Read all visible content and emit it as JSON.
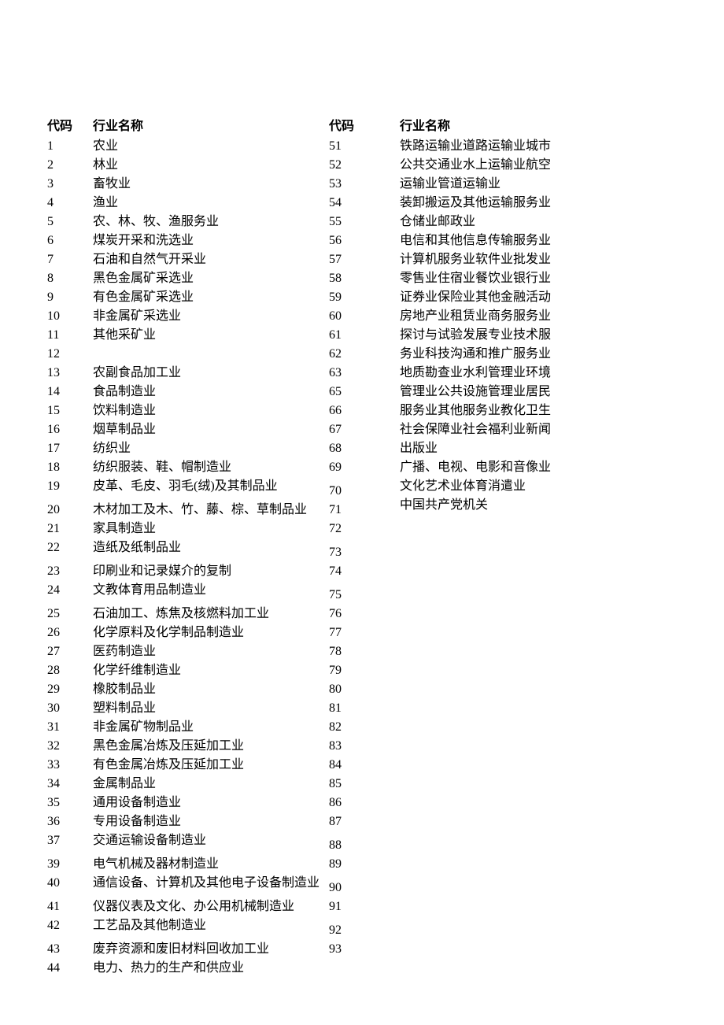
{
  "headers": {
    "code": "代码",
    "name": "行业名称"
  },
  "left_rows": [
    {
      "code": "1",
      "name": "农业"
    },
    {
      "code": "2",
      "name": "林业"
    },
    {
      "code": "3",
      "name": "畜牧业"
    },
    {
      "code": "4",
      "name": "渔业"
    },
    {
      "code": "5",
      "name": "农、林、牧、渔服务业"
    },
    {
      "code": "6",
      "name": "煤炭开采和洗选业"
    },
    {
      "code": "7",
      "name": "石油和自然气开采业"
    },
    {
      "code": "8",
      "name": "黑色金属矿采选业"
    },
    {
      "code": "9",
      "name": "有色金属矿采选业"
    },
    {
      "code": "10",
      "name": "非金属矿采选业"
    },
    {
      "code": "11",
      "name": "其他采矿业"
    },
    {
      "code": "12",
      "name": ""
    },
    {
      "code": "13",
      "name": "农副食品加工业"
    },
    {
      "code": "14",
      "name": "食品制造业"
    },
    {
      "code": "15",
      "name": "饮料制造业"
    },
    {
      "code": "16",
      "name": "烟草制品业"
    },
    {
      "code": "17",
      "name": "纺织业"
    },
    {
      "code": "18",
      "name": "纺织服装、鞋、帽制造业"
    },
    {
      "code": "19",
      "name": "皮革、毛皮、羽毛(绒)及其制品业"
    },
    "spacer",
    {
      "code": "20",
      "name": "木材加工及木、竹、藤、棕、草制品业"
    },
    {
      "code": "21",
      "name": "家具制造业"
    },
    {
      "code": "22",
      "name": "造纸及纸制品业"
    },
    "spacer",
    {
      "code": "23",
      "name": "印刷业和记录媒介的复制"
    },
    {
      "code": "24",
      "name": "文教体育用品制造业"
    },
    "spacer",
    {
      "code": "25",
      "name": "石油加工、炼焦及核燃料加工业"
    },
    {
      "code": "26",
      "name": "化学原料及化学制品制造业"
    },
    {
      "code": "27",
      "name": "医药制造业"
    },
    {
      "code": "28",
      "name": "化学纤维制造业"
    },
    {
      "code": "29",
      "name": "橡胶制品业"
    },
    {
      "code": "30",
      "name": "塑料制品业"
    },
    {
      "code": "31",
      "name": "非金属矿物制品业"
    },
    {
      "code": "32",
      "name": "黑色金属冶炼及压延加工业"
    },
    {
      "code": "33",
      "name": "有色金属冶炼及压延加工业"
    },
    {
      "code": "34",
      "name": "金属制品业"
    },
    {
      "code": "35",
      "name": "通用设备制造业"
    },
    {
      "code": "36",
      "name": "专用设备制造业"
    },
    {
      "code": "37",
      "name": "交通运输设备制造业"
    },
    "spacer",
    {
      "code": "39",
      "name": "电气机械及器材制造业"
    },
    {
      "code": "40",
      "name": "通信设备、计算机及其他电子设备制造业"
    },
    "spacer",
    {
      "code": "41",
      "name": "仪器仪表及文化、办公用机械制造业"
    },
    {
      "code": "42",
      "name": "工艺品及其他制造业"
    },
    "spacer",
    {
      "code": "43",
      "name": "废弃资源和废旧材料回收加工业"
    },
    {
      "code": "44",
      "name": "电力、热力的生产和供应业"
    }
  ],
  "mid_codes": [
    "51",
    "52",
    "53",
    "54",
    "55",
    "56",
    "57",
    "58",
    "59",
    "60",
    "61",
    "62",
    "63",
    "65",
    "66",
    "67",
    "68",
    "69",
    "spacer",
    "70",
    "71",
    "72",
    "spacer",
    "73",
    "74",
    "spacer",
    "75",
    "76",
    "77",
    "78",
    "79",
    "80",
    "81",
    "82",
    "83",
    "84",
    "85",
    "86",
    "87",
    "spacer",
    "88",
    "89",
    "spacer",
    "90",
    "91",
    "spacer",
    "92",
    "93"
  ],
  "right_lines": [
    "铁路运输业道路运输业城市",
    "公共交通业水上运输业航空",
    "运输业管道运输业",
    "装卸搬运及其他运输服务业",
    "仓储业邮政业",
    "电信和其他信息传输服务业",
    "计算机服务业软件业批发业",
    "零售业住宿业餐饮业银行业",
    "证券业保险业其他金融活动",
    "房地产业租赁业商务服务业",
    "探讨与试验发展专业技术服",
    "务业科技沟通和推广服务业",
    "地质勘查业水利管理业环境",
    "管理业公共设施管理业居民",
    "服务业其他服务业教化卫生",
    "社会保障业社会福利业新闻",
    "出版业",
    "广播、电视、电影和音像业",
    "文化艺术业体育消遣业",
    "中国共产党机关"
  ]
}
